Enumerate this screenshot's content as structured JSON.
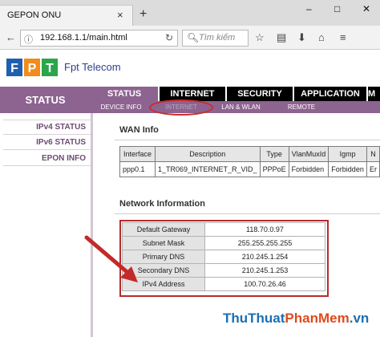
{
  "browser": {
    "tab_title": "GEPON ONU",
    "tab_close": "×",
    "new_tab": "+",
    "window_buttons": [
      "–",
      "□",
      "✕"
    ],
    "url": "192.168.1.1/main.html",
    "search_placeholder": "Tìm kiếm",
    "nav_icons": [
      "back-icon",
      "info-icon",
      "reload-icon",
      "search-icon",
      "star-icon",
      "reader-icon",
      "download-icon",
      "home-icon",
      "menu-icon"
    ]
  },
  "header": {
    "logo_letters": [
      "F",
      "P",
      "T"
    ],
    "brand_name": "Fpt Telecom"
  },
  "status_side_label": "STATUS",
  "main_tabs": [
    {
      "label": "STATUS",
      "active": true
    },
    {
      "label": "INTERNET",
      "active": false
    },
    {
      "label": "SECURITY",
      "active": false
    },
    {
      "label": "APPLICATION",
      "active": false
    },
    {
      "label": "M",
      "active": false
    }
  ],
  "sub_tabs": [
    {
      "label": "DEVICE INFO",
      "active": false
    },
    {
      "label": "INTERNET",
      "active": true
    },
    {
      "label": "LAN & WLAN",
      "active": false
    },
    {
      "label": "REMOTE",
      "active": false
    }
  ],
  "sidebar": {
    "items": [
      "IPv4 STATUS",
      "IPv6 STATUS",
      "EPON INFO"
    ]
  },
  "wan": {
    "title": "WAN Info",
    "columns": [
      "Interface",
      "Description",
      "Type",
      "VlanMuxId",
      "Igmp",
      "N"
    ],
    "rows": [
      [
        "ppp0.1",
        "1_TR069_INTERNET_R_VID_",
        "PPPoE",
        "Forbidden",
        "Forbidden",
        "Er"
      ]
    ]
  },
  "network": {
    "title": "Network Information",
    "rows": [
      {
        "key": "Default Gateway",
        "value": "118.70.0.97"
      },
      {
        "key": "Subnet Mask",
        "value": "255.255.255.255"
      },
      {
        "key": "Primary DNS",
        "value": "210.245.1.254"
      },
      {
        "key": "Secondary DNS",
        "value": "210.245.1.253"
      },
      {
        "key": "IPv4 Address",
        "value": "100.70.26.46"
      }
    ]
  },
  "watermark": {
    "parts": [
      "ThuThuat",
      "PhanMem",
      ".vn"
    ],
    "colors": [
      "#1a6fb5",
      "#e04a1d",
      "#1a6fb5"
    ]
  },
  "colors": {
    "accent_purple": "#8d6390",
    "nav_black": "#000000",
    "highlight_red": "#b52b2b"
  }
}
